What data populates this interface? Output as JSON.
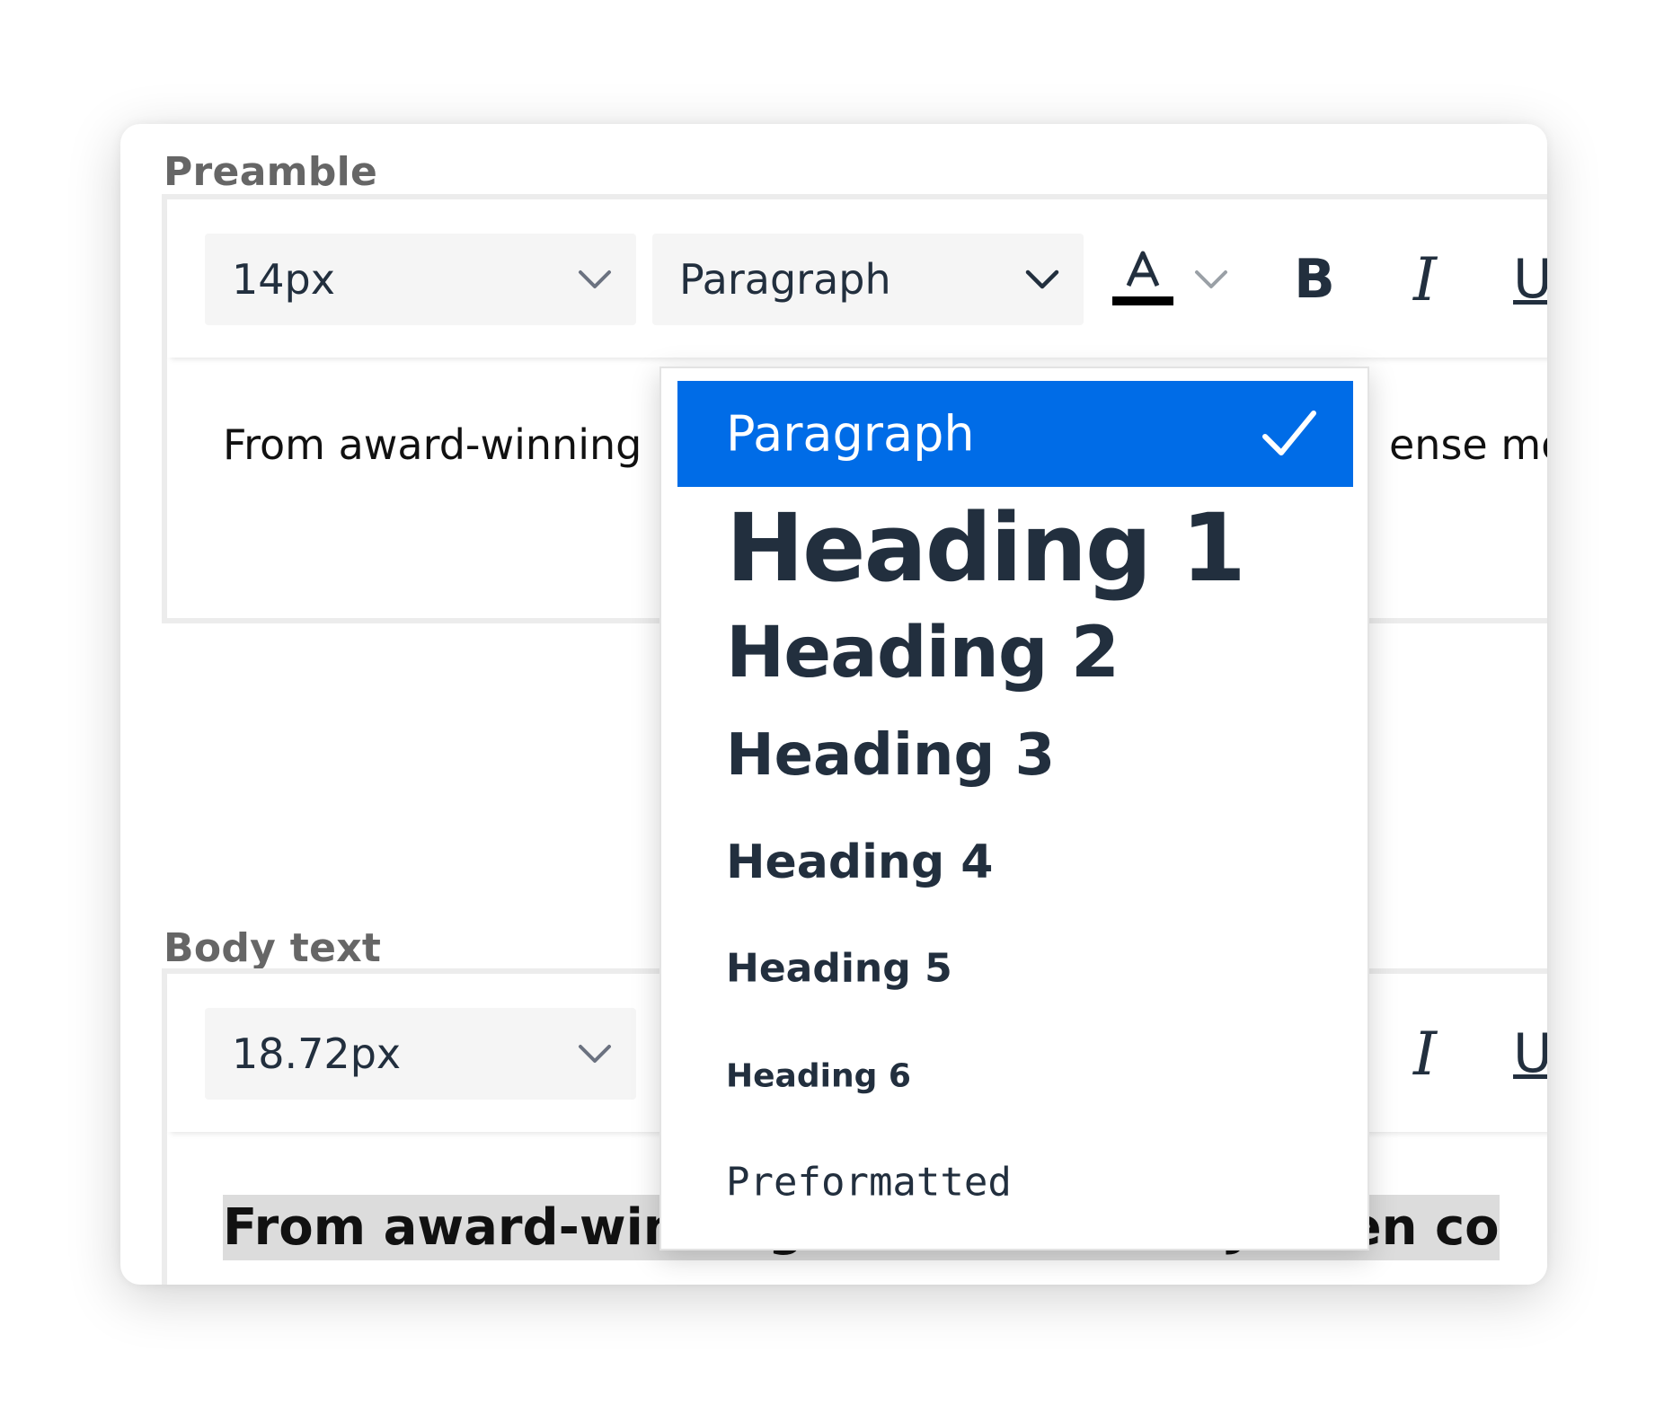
{
  "preamble": {
    "label": "Preamble",
    "font_size": "14px",
    "block_format": "Paragraph",
    "text_left": "From award-winning",
    "text_right": "ense mod"
  },
  "body_text": {
    "label": "Body text",
    "font_size": "18.72px",
    "text": "From award-winning director Clara Jensen co"
  },
  "toolbar": {
    "text_color_icon": "text-color-icon",
    "text_color_swatch": "#000000",
    "bold_label": "B",
    "italic_label": "I",
    "underline_label": "U"
  },
  "dropdown": {
    "selected": "Paragraph",
    "items": [
      {
        "label": "Paragraph"
      },
      {
        "label": "Heading 1"
      },
      {
        "label": "Heading 2"
      },
      {
        "label": "Heading 3"
      },
      {
        "label": "Heading 4"
      },
      {
        "label": "Heading 5"
      },
      {
        "label": "Heading 6"
      },
      {
        "label": "Preformatted"
      }
    ]
  },
  "colors": {
    "accent": "#006ce7",
    "text": "#222f3e",
    "label": "#666666"
  }
}
